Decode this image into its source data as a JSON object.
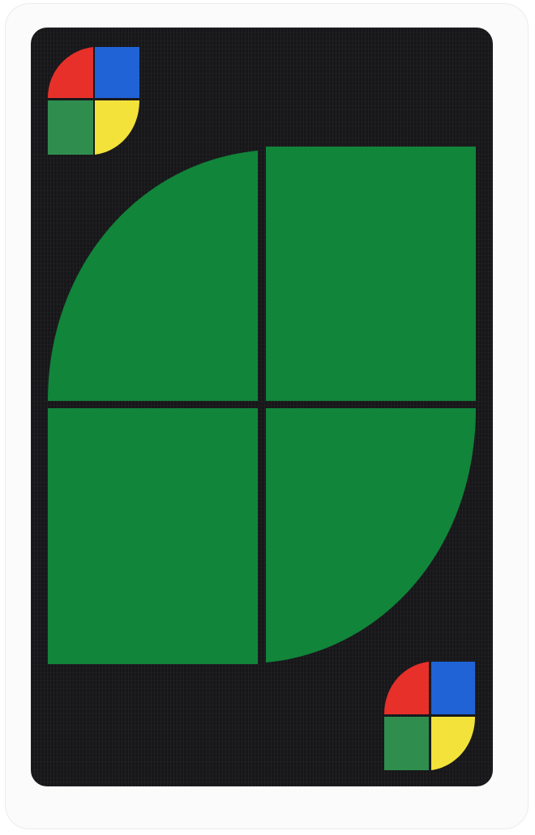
{
  "card": {
    "type": "wild-card",
    "background_color": "#17171a",
    "border_color": "#fbfbfb",
    "divider_color": "#17171a"
  },
  "big_emblem": {
    "selected_color_name": "green",
    "quadrants": [
      {
        "position": "top-left",
        "color": "#11853a"
      },
      {
        "position": "top-right",
        "color": "#11853a"
      },
      {
        "position": "bottom-left",
        "color": "#11853a"
      },
      {
        "position": "bottom-right",
        "color": "#11853a"
      }
    ]
  },
  "corner_emblems": {
    "quadrants": [
      {
        "position": "top-left",
        "color_name": "red",
        "color": "#e8302a"
      },
      {
        "position": "top-right",
        "color_name": "blue",
        "color": "#1f63d6"
      },
      {
        "position": "bottom-left",
        "color_name": "green",
        "color": "#2f8e4e"
      },
      {
        "position": "bottom-right",
        "color_name": "yellow",
        "color": "#f2e23a"
      }
    ]
  }
}
